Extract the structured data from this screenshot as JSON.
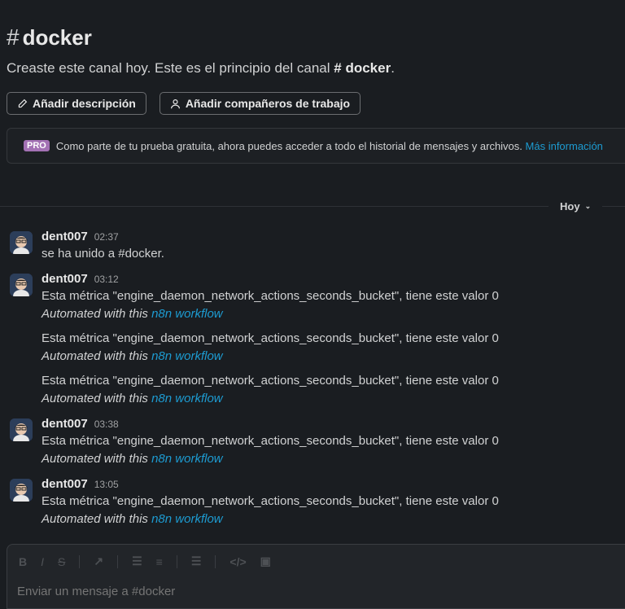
{
  "channel": {
    "hash": "#",
    "name": "docker",
    "intro_text": "Creaste este canal hoy. Este es el principio del canal",
    "intro_channel": "# docker",
    "intro_end": "."
  },
  "buttons": {
    "add_description": "Añadir descripción",
    "add_teammates": "Añadir compañeros de trabajo"
  },
  "pro_banner": {
    "badge": "PRO",
    "text": "Como parte de tu prueba gratuita, ahora puedes acceder a todo el historial de mensajes y archivos.",
    "link": "Más información"
  },
  "day_divider": {
    "label": "Hoy",
    "chevron": "⌄"
  },
  "messages": [
    {
      "author": "dent007",
      "time": "02:37",
      "lines": [
        {
          "text": "se ha unido a #docker."
        }
      ]
    },
    {
      "author": "dent007",
      "time": "03:12",
      "lines": [
        {
          "text": "Esta métrica \"engine_daemon_network_actions_seconds_bucket\", tiene este valor  0",
          "auto": "Automated with this",
          "auto_link": "n8n workflow"
        },
        {
          "text": "Esta métrica \"engine_daemon_network_actions_seconds_bucket\", tiene este valor  0",
          "auto": "Automated with this",
          "auto_link": "n8n workflow"
        },
        {
          "text": "Esta métrica \"engine_daemon_network_actions_seconds_bucket\", tiene este valor  0",
          "auto": "Automated with this",
          "auto_link": "n8n workflow"
        }
      ]
    },
    {
      "author": "dent007",
      "time": "03:38",
      "lines": [
        {
          "text": "Esta métrica \"engine_daemon_network_actions_seconds_bucket\", tiene este valor  0",
          "auto": "Automated with this",
          "auto_link": "n8n workflow"
        }
      ]
    },
    {
      "author": "dent007",
      "time": "13:05",
      "lines": [
        {
          "text": "Esta métrica \"engine_daemon_network_actions_seconds_bucket\", tiene este valor  0",
          "auto": "Automated with this",
          "auto_link": "n8n workflow"
        }
      ]
    }
  ],
  "composer": {
    "placeholder": "Enviar un mensaje a #docker",
    "toolbar_icons": [
      "bold-icon",
      "italic-icon",
      "strikethrough-icon",
      "link-icon",
      "ordered-list-icon",
      "bulleted-list-icon",
      "blockquote-icon",
      "code-icon",
      "code-block-icon"
    ]
  },
  "colors": {
    "background": "#1a1d21",
    "link": "#1d9bd1",
    "pro_badge": "#a371b4"
  }
}
